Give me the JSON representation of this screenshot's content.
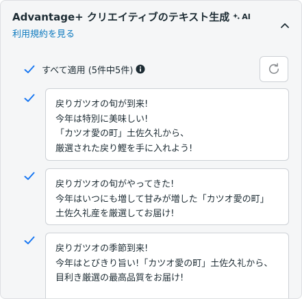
{
  "header": {
    "title": "Advantage+ クリエイティブのテキスト生成",
    "ai_label": "AI",
    "terms_link": "利用規約を見る"
  },
  "select_all": {
    "label": "すべて適用 (5件中5件)",
    "checked": true
  },
  "items": [
    {
      "checked": true,
      "lines": [
        "戻りガツオの旬が到来!",
        "今年は特別に美味しい!",
        "「カツオ愛の町」土佐久礼から、",
        "厳選された戻り鰹を手に入れよう!"
      ]
    },
    {
      "checked": true,
      "lines": [
        "戻りガツオの旬がやってきた!",
        "今年はいつにも増して甘みが増した「カツオ愛の町」",
        "土佐久礼産を厳選してお届け!"
      ]
    },
    {
      "checked": true,
      "lines": [
        "戻りガツオの季節到来!",
        "今年はとびきり旨い!「カツオ愛の町」土佐久礼から、",
        "目利き厳選の最高品質をお届け!"
      ]
    }
  ],
  "colors": {
    "accent": "#0a78be",
    "check": "#1877f2",
    "text": "#1c2b33",
    "panel_bg": "#f5f6f7"
  },
  "icons": [
    "sparkle-icon",
    "chevron-up-icon",
    "checkmark-icon",
    "info-icon",
    "refresh-icon"
  ]
}
